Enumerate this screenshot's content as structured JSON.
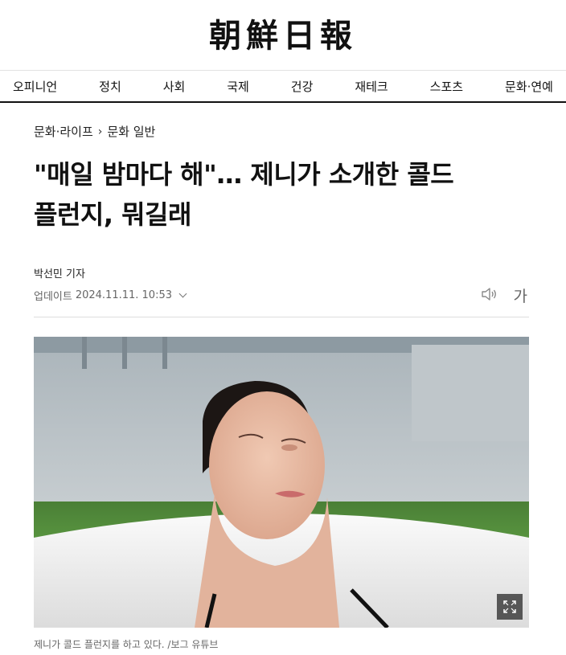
{
  "masthead": {
    "logo_text": "朝鮮日報"
  },
  "nav": {
    "items": [
      {
        "label": "오피니언"
      },
      {
        "label": "정치"
      },
      {
        "label": "사회"
      },
      {
        "label": "국제"
      },
      {
        "label": "건강"
      },
      {
        "label": "재테크"
      },
      {
        "label": "스포츠"
      },
      {
        "label": "문화·연예"
      }
    ]
  },
  "article": {
    "breadcrumb": {
      "section": "문화·라이프",
      "subsection": "문화 일반"
    },
    "headline_line1": "\"매일 밤마다 해\"… 제니가 소개한 콜드",
    "headline_line2": "플런지, 뭐길래",
    "byline": "박선민 기자",
    "updated_label": "업데이트",
    "updated_time": "2024.11.11. 10:53",
    "font_size_label": "가",
    "image": {
      "caption": "제니가 콜드 플런지를 하고 있다. /보그 유튜브",
      "icons": {
        "expand": "expand-icon",
        "listen": "speaker-icon"
      }
    }
  },
  "colors": {
    "text": "#111111",
    "muted": "#666666",
    "rule": "#111111",
    "grass": "#4f8a3a",
    "tub": "#f2f2f2"
  }
}
